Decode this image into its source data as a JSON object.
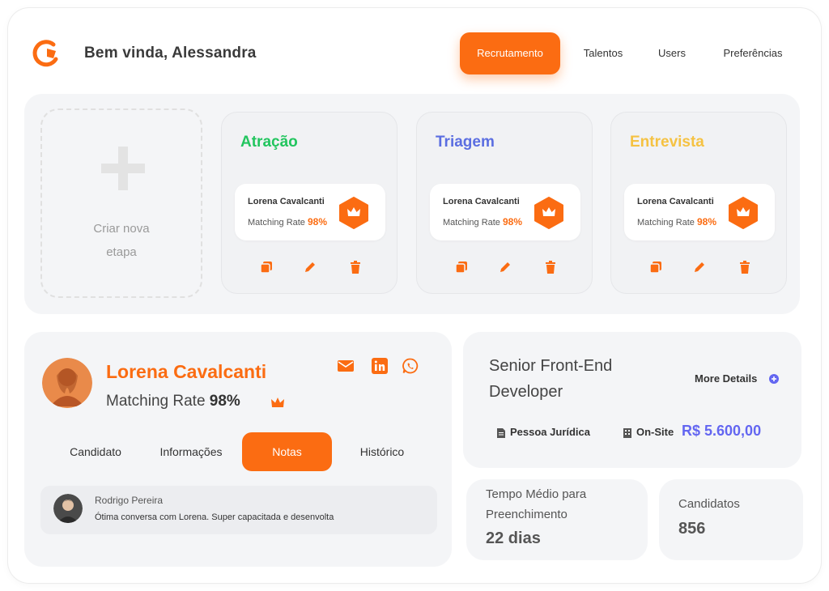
{
  "header": {
    "greeting": "Bem vinda, Alessandra",
    "logo_icon": "logo-icon",
    "nav": [
      {
        "label": "Recrutamento",
        "active": true
      },
      {
        "label": "Talentos",
        "active": false
      },
      {
        "label": "Users",
        "active": false
      },
      {
        "label": "Preferências",
        "active": false
      }
    ]
  },
  "colors": {
    "accent": "#fb6c12",
    "atracao": "#22c55e",
    "triagem": "#5b6ee1",
    "entrevista": "#f5c242",
    "salary": "#6366f1"
  },
  "stages": {
    "create_label_line1": "Criar nova",
    "create_label_line2": "etapa",
    "items": [
      {
        "title": "Atração",
        "candidate": "Lorena Cavalcanti",
        "rate_label": "Matching Rate",
        "rate": "98%"
      },
      {
        "title": "Triagem",
        "candidate": "Lorena Cavalcanti",
        "rate_label": "Matching Rate",
        "rate": "98%"
      },
      {
        "title": "Entrevista",
        "candidate": "Lorena Cavalcanti",
        "rate_label": "Matching Rate",
        "rate": "98%"
      }
    ],
    "action_icons": [
      "copy-icon",
      "pencil-icon",
      "trash-icon"
    ]
  },
  "profile": {
    "name": "Lorena Cavalcanti",
    "rate_label": "Matching Rate",
    "rate": "98%",
    "social_icons": [
      "mail-icon",
      "linkedin-icon",
      "whatsapp-icon"
    ],
    "tabs": [
      {
        "label": "Candidato",
        "active": false
      },
      {
        "label": "Informações",
        "active": false
      },
      {
        "label": "Notas",
        "active": true
      },
      {
        "label": "Histórico",
        "active": false
      }
    ],
    "note": {
      "author": "Rodrigo Pereira",
      "text": "Ótima conversa com Lorena. Super capacitada e desenvolta"
    }
  },
  "job": {
    "title": "Senior Front-End Developer",
    "more_details": "More Details",
    "contract": "Pessoa Jurídica",
    "location": "On-Site",
    "salary": "R$ 5.600,00"
  },
  "stats": {
    "fill_time_label": "Tempo Médio para Preenchimento",
    "fill_time_value": "22 dias",
    "candidates_label": "Candidatos",
    "candidates_value": "856"
  }
}
